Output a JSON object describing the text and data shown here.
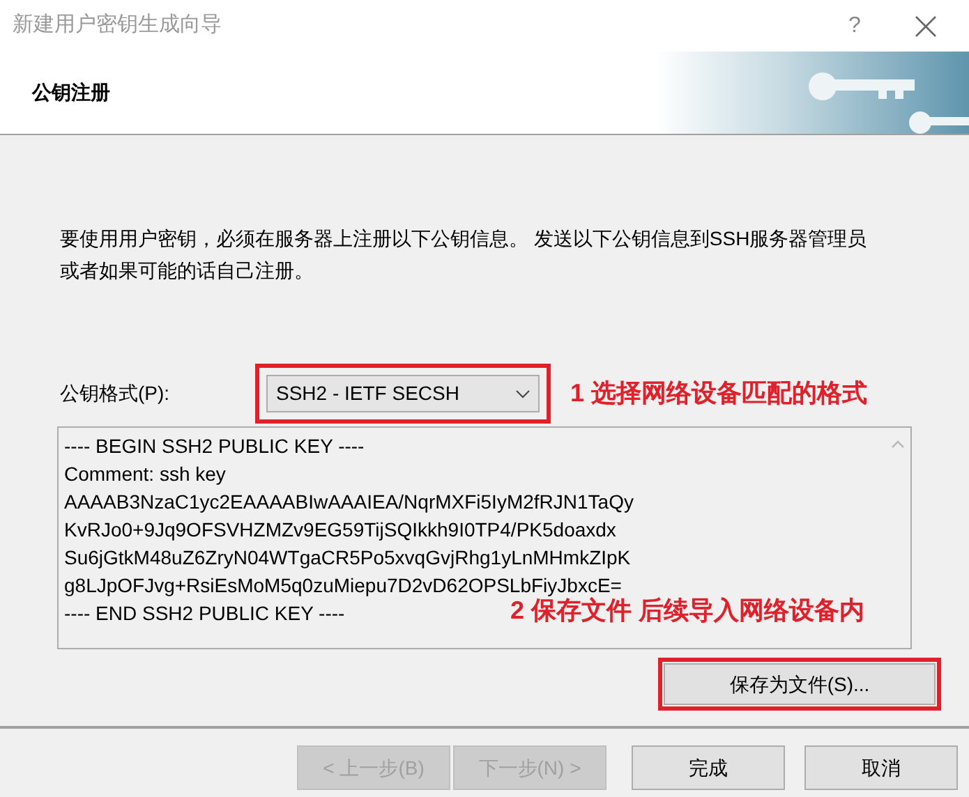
{
  "window": {
    "title": "新建用户密钥生成向导",
    "help": "?"
  },
  "header": {
    "title": "公钥注册"
  },
  "description": "要使用用户密钥，必须在服务器上注册以下公钥信息。 发送以下公钥信息到SSH服务器管理员或者如果可能的话自己注册。",
  "format": {
    "label": "公钥格式(P):",
    "value": "SSH2 - IETF SECSH"
  },
  "public_key": [
    "---- BEGIN SSH2 PUBLIC KEY ----",
    "Comment: ssh key",
    "AAAAB3NzaC1yc2EAAAABIwAAAIEA/NqrMXFi5IyM2fRJN1TaQy",
    "KvRJo0+9Jq9OFSVHZMZv9EG59TijSQIkkh9I0TP4/PK5doaxdx",
    "Su6jGtkM48uZ6ZryN04WTgaCR5Po5xvqGvjRhg1yLnMHmkZIpK",
    "g8LJpOFJvg+RsiEsMoM5q0zuMiepu7D2vD62OPSLbFiyJbxcE=",
    "---- END SSH2 PUBLIC KEY ----"
  ],
  "save_button": "保存为文件(S)...",
  "annotations": [
    "1 选择网络设备匹配的格式",
    "2 保存文件 后续导入网络设备内"
  ],
  "buttons": [
    {
      "label": "< 上一步(B)",
      "disabled": true
    },
    {
      "label": "下一步(N) >",
      "disabled": true
    },
    {
      "label": "完成",
      "disabled": false
    },
    {
      "label": "取消",
      "disabled": false
    }
  ]
}
